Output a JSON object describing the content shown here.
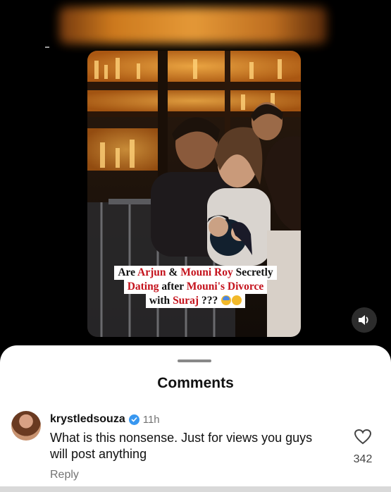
{
  "video": {
    "caption": {
      "w1": "Are",
      "w2": "Arjun",
      "w3": "&",
      "w4": "Mouni Roy",
      "w5": "Secretly",
      "w6": "Dating",
      "w7": "after",
      "w8": "Mouni's Divorce",
      "w9": "with",
      "w10": "Suraj",
      "w11": "???"
    },
    "accent_color": "#c4121c",
    "sound_icon": "speaker-icon"
  },
  "comments_sheet": {
    "title": "Comments",
    "comment": {
      "username": "krystledsouza",
      "verified_icon": "verified-badge-icon",
      "time": "11h",
      "text": "What is this nonsense. Just for views you guys will post anything",
      "reply_label": "Reply",
      "like_icon": "heart-icon",
      "like_count": "342"
    }
  }
}
